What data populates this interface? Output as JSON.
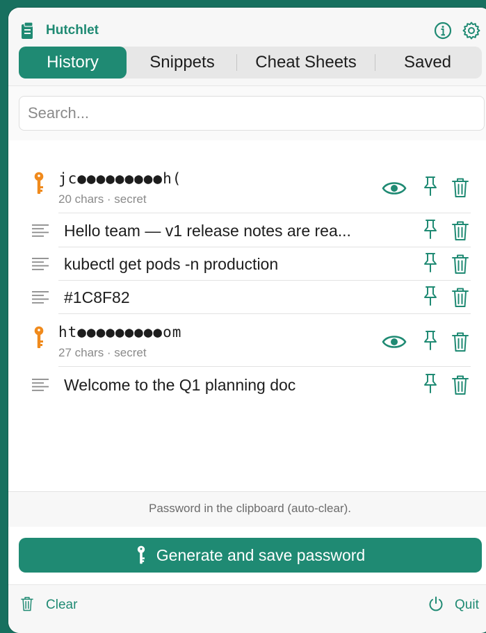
{
  "app": {
    "title": "Hutchlet"
  },
  "colors": {
    "accent": "#1f8a73",
    "secret_key": "#f08a1c",
    "background": "#17705f"
  },
  "tabs": [
    {
      "label": "History",
      "active": true
    },
    {
      "label": "Snippets",
      "active": false
    },
    {
      "label": "Cheat Sheets",
      "active": false
    },
    {
      "label": "Saved",
      "active": false
    }
  ],
  "search": {
    "placeholder": "Search...",
    "value": ""
  },
  "history": [
    {
      "kind": "secret",
      "masked": "jc●●●●●●●●●h(",
      "meta": "20 chars · secret",
      "icon": "key-icon"
    },
    {
      "kind": "text",
      "text": "Hello team — v1 release notes are rea...",
      "icon": "text-lines-icon"
    },
    {
      "kind": "text",
      "text": "kubectl get pods -n production",
      "icon": "text-lines-icon"
    },
    {
      "kind": "text",
      "text": "#1C8F82",
      "icon": "text-lines-icon"
    },
    {
      "kind": "secret",
      "masked": "ht●●●●●●●●●om",
      "meta": "27 chars · secret",
      "icon": "key-icon"
    },
    {
      "kind": "text",
      "text": "Welcome to the Q1 planning doc",
      "icon": "text-lines-icon"
    }
  ],
  "status": {
    "clipboard_note": "Password in the clipboard (auto-clear)."
  },
  "actions": {
    "generate_label": "Generate and save password"
  },
  "footer": {
    "clear_label": "Clear",
    "quit_label": "Quit"
  }
}
